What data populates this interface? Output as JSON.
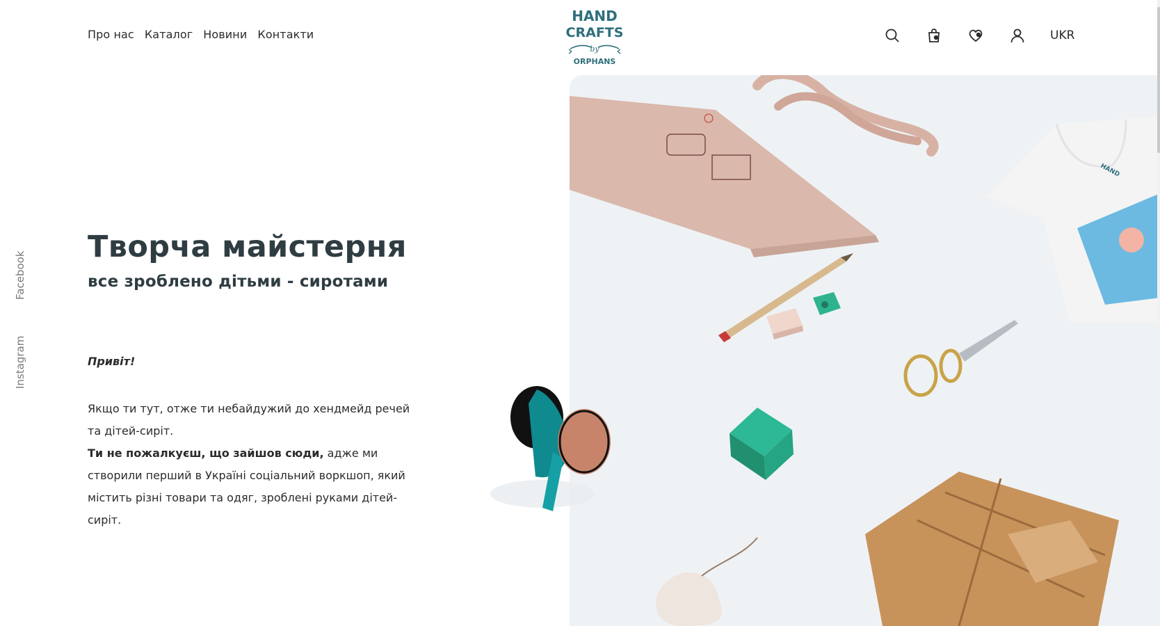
{
  "nav": {
    "items": [
      "Про нас",
      "Каталог",
      "Новини",
      "Контакти"
    ]
  },
  "logo": {
    "line1": "HAND",
    "line2": "CRAFTS",
    "line3": "by",
    "line4": "ORPHANS"
  },
  "header": {
    "icons": [
      "search-icon",
      "cart-icon",
      "wishlist-heart-icon",
      "user-icon"
    ],
    "lang": "UKR"
  },
  "social": {
    "facebook": "Facebook",
    "instagram": "Instagram"
  },
  "hero": {
    "title": "Творча майстерня",
    "subtitle": "все зроблено дітьми - сиротами",
    "greeting": "Привіт!",
    "para1": "Якщо ти тут, отже ти небайдужий до хендмейд речей та дітей-сиріт.",
    "para2_bold": "Ти не пожалкуєш, що зайшов сюди,",
    "para2_rest": " адже ми створили перший в Україні соціальний воркшоп, який містить різні товари та одяг, зроблені руками дітей-сиріт."
  },
  "colors": {
    "brand": "#2e6f7b",
    "text": "#2f3d42",
    "panel_bg": "#eef2f5"
  }
}
